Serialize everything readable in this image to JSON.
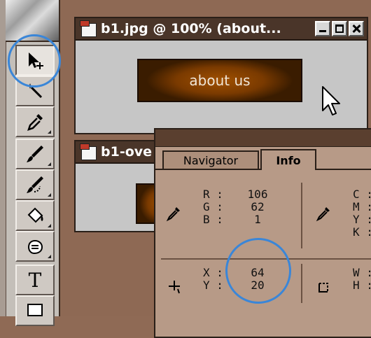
{
  "toolbox": {
    "tools": [
      {
        "name": "move-tool",
        "active": true
      },
      {
        "name": "magic-wand-tool"
      },
      {
        "name": "eyedropper-tool"
      },
      {
        "name": "brush-tool"
      },
      {
        "name": "history-brush-tool"
      },
      {
        "name": "paint-bucket-tool"
      },
      {
        "name": "dodge-tool"
      },
      {
        "name": "type-tool",
        "label": "T"
      },
      {
        "name": "rectangle-marquee-tool"
      }
    ]
  },
  "windows": [
    {
      "title": "b1.jpg @ 100% (about...",
      "button_text": "about us"
    },
    {
      "title": "b1-ove"
    }
  ],
  "palette": {
    "tabs": [
      "Navigator",
      "Info"
    ],
    "active_tab": "Info",
    "rgb": {
      "labels": [
        "R :",
        "G :",
        "B :"
      ],
      "values": [
        "106",
        "62",
        "1"
      ]
    },
    "cmyk": {
      "labels": [
        "C :",
        "M :",
        "Y :",
        "K :"
      ]
    },
    "xy": {
      "labels": [
        "X :",
        "Y :"
      ],
      "values": [
        "64",
        "20"
      ]
    },
    "wh": {
      "labels": [
        "W :",
        "H :"
      ]
    }
  },
  "colors": {
    "highlight": "#3a86d8",
    "button_bg": "#3a1c00",
    "workspace": "#8e6954"
  }
}
